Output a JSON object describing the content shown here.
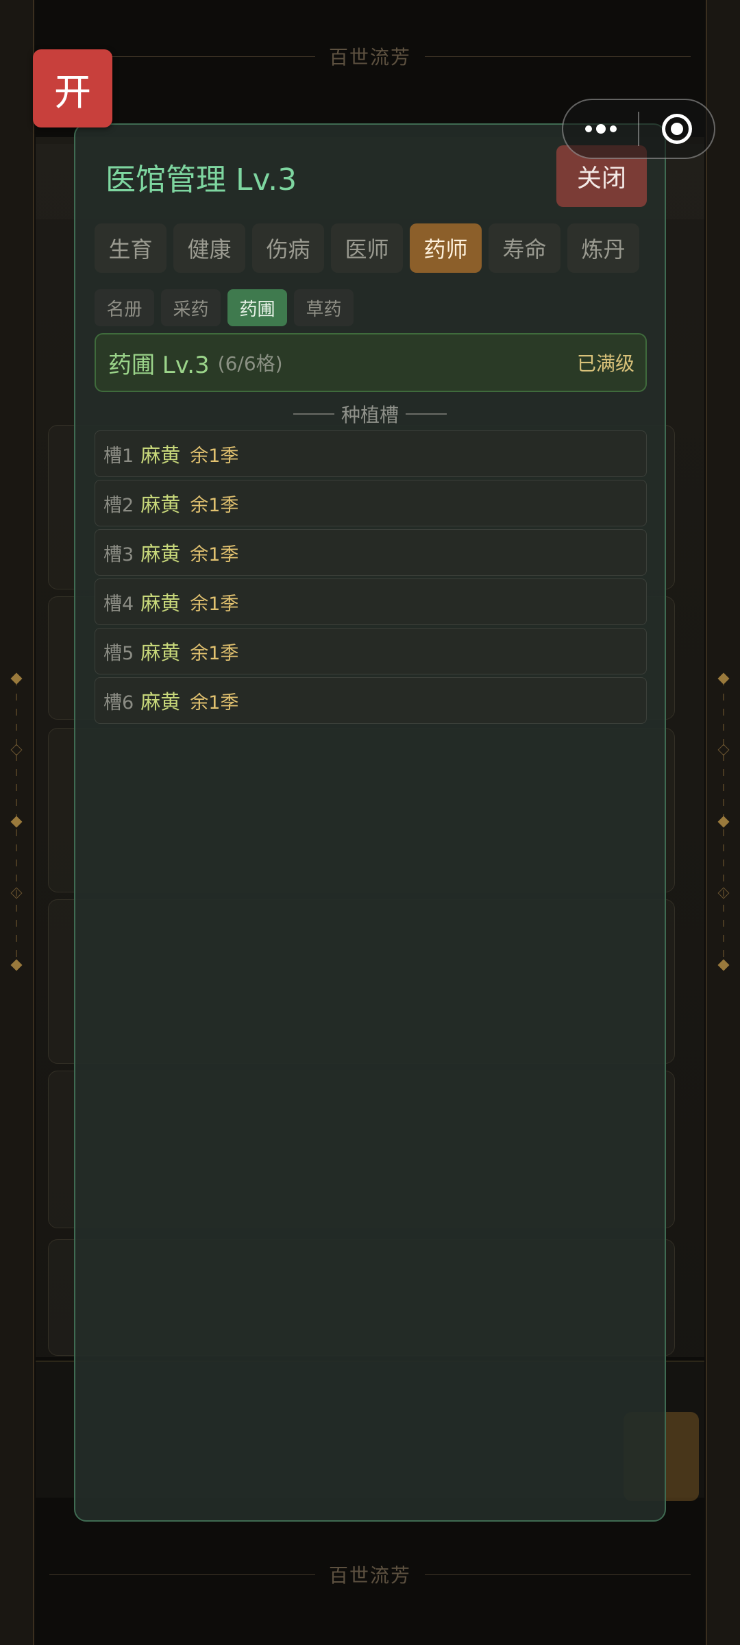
{
  "banner": {
    "title": "百世流芳"
  },
  "launcher": {
    "label": "开"
  },
  "modal": {
    "title": "医馆管理 Lv.3",
    "close_label": "关闭",
    "tabs": [
      "生育",
      "健康",
      "伤病",
      "医师",
      "药师",
      "寿命",
      "炼丹"
    ],
    "active_tab": "药师",
    "subtabs": [
      "名册",
      "采药",
      "药圃",
      "草药"
    ],
    "active_subtab": "药圃",
    "garden": {
      "title": "药圃 Lv.3",
      "capacity": "(6/6格)",
      "status": "已满级"
    },
    "section_title": "种植槽",
    "slots": [
      {
        "label": "槽1",
        "herb": "麻黄",
        "remaining": "余1季"
      },
      {
        "label": "槽2",
        "herb": "麻黄",
        "remaining": "余1季"
      },
      {
        "label": "槽3",
        "herb": "麻黄",
        "remaining": "余1季"
      },
      {
        "label": "槽4",
        "herb": "麻黄",
        "remaining": "余1季"
      },
      {
        "label": "槽5",
        "herb": "麻黄",
        "remaining": "余1季"
      },
      {
        "label": "槽6",
        "herb": "麻黄",
        "remaining": "余1季"
      }
    ]
  },
  "colors": {
    "accent_green": "#7ed6a0",
    "active_tab": "#8c5f2a",
    "active_subtab": "#3f7a4e",
    "close_button": "#7b3c36",
    "launcher": "#c8403c"
  }
}
